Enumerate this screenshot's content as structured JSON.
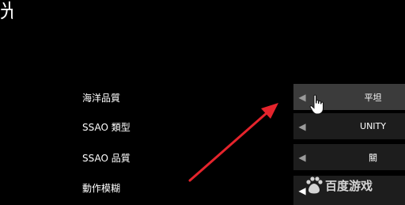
{
  "header": {
    "corner_glyph": "光"
  },
  "settings": [
    {
      "label": "海洋品質",
      "value": "平坦"
    },
    {
      "label": "SSAO 類型",
      "value": "UNITY"
    },
    {
      "label": "SSAO 品質",
      "value": "關"
    },
    {
      "label": "動作模糊",
      "value": ""
    }
  ],
  "icons": {
    "left_arrow": "◀"
  },
  "watermark": {
    "text": "百度游戏"
  },
  "colors": {
    "annotation_arrow": "#e5242c",
    "row_bg": "#1d1d1d",
    "row_active_bg": "#3b3b3b"
  }
}
